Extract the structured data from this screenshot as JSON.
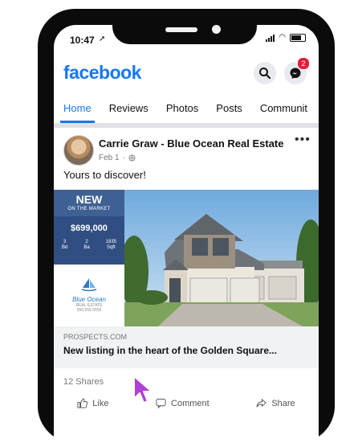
{
  "status_bar": {
    "time": "10:47"
  },
  "header": {
    "logo": "facebook",
    "messenger_badge": "2"
  },
  "tabs": [
    {
      "label": "Home",
      "active": true
    },
    {
      "label": "Reviews",
      "active": false
    },
    {
      "label": "Photos",
      "active": false
    },
    {
      "label": "Posts",
      "active": false
    },
    {
      "label": "Communit",
      "active": false
    }
  ],
  "post": {
    "author": "Carrie Graw - Blue Ocean Real Estate",
    "date": "Feb 1",
    "text": "Yours to discover!",
    "flyer": {
      "new_title": "NEW",
      "new_subtitle": "ON THE MARKET",
      "price": "$699,000",
      "specs": [
        {
          "value": "3",
          "unit": "Bd"
        },
        {
          "value": "2",
          "unit": "Ba"
        },
        {
          "value": "1835",
          "unit": "Sqft"
        }
      ],
      "brand_name": "Blue Ocean",
      "brand_small_1": "REAL ESTATE",
      "brand_small_2": "555.555.5555"
    },
    "link": {
      "domain": "PROSPECTS.COM",
      "title": "New listing in the heart of the Golden Square..."
    },
    "shares": "12 Shares",
    "actions": {
      "like": "Like",
      "comment": "Comment",
      "share": "Share"
    }
  },
  "colors": {
    "brand": "#1877f2",
    "flyer_blue": "#304e82",
    "badge": "#e41e3f"
  }
}
